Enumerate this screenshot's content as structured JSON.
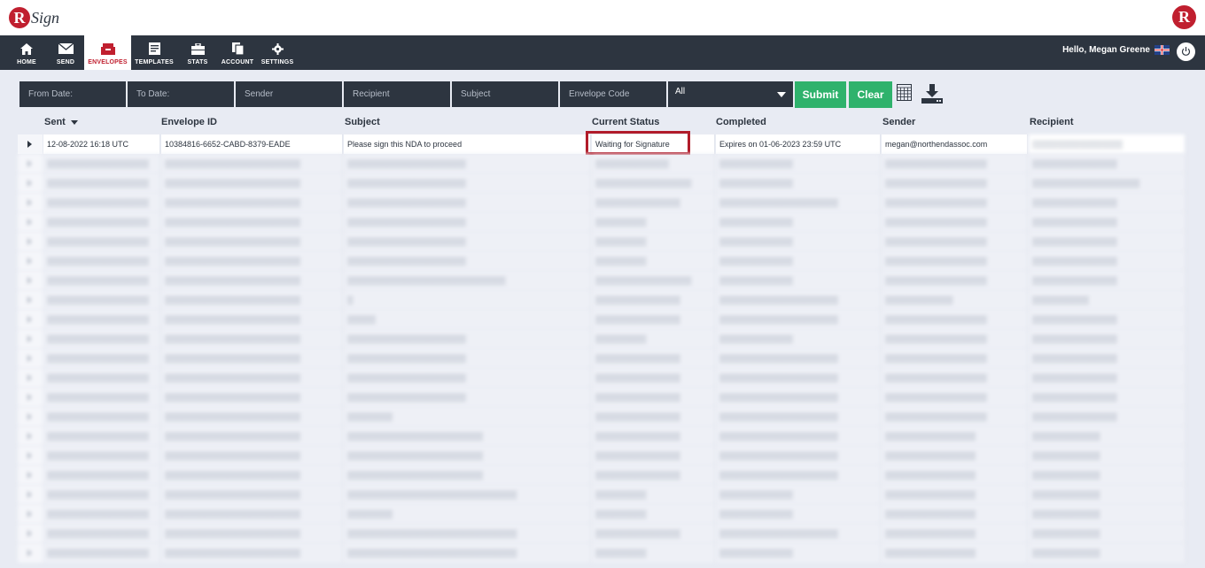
{
  "brand": {
    "logo_letter": "R",
    "logo_text": "Sign"
  },
  "nav": {
    "items": [
      {
        "label": "HOME",
        "icon": "home-icon"
      },
      {
        "label": "SEND",
        "icon": "envelope-icon"
      },
      {
        "label": "ENVELOPES",
        "icon": "inbox-icon"
      },
      {
        "label": "TEMPLATES",
        "icon": "template-icon"
      },
      {
        "label": "STATS",
        "icon": "briefcase-icon"
      },
      {
        "label": "ACCOUNT",
        "icon": "account-icon"
      },
      {
        "label": "SETTINGS",
        "icon": "gear-icon"
      }
    ],
    "active": "ENVELOPES"
  },
  "user": {
    "greeting": "Hello, Megan Greene"
  },
  "filters": {
    "from_date": "From Date:",
    "to_date": "To Date:",
    "sender": "Sender",
    "recipient": "Recipient",
    "subject": "Subject",
    "envelope_code": "Envelope Code",
    "status_select": "All",
    "submit": "Submit",
    "clear": "Clear"
  },
  "table": {
    "columns": [
      "Sent",
      "Envelope ID",
      "Subject",
      "Current Status",
      "Completed",
      "Sender",
      "Recipient"
    ],
    "first_row": {
      "sent": "12-08-2022 16:18 UTC",
      "envelope_id": "10384816-6652-CABD-8379-EADE",
      "subject": "Please sign this NDA to proceed",
      "status": "Waiting for Signature",
      "completed": "Expires on 01-06-2023 23:59 UTC",
      "sender": "megan@northendassoc.com",
      "recipient": "▒▒▒▒▒▒▒▒▒▒▒▒▒▒▒▒"
    },
    "blurred_rows": [
      [
        "▒▒▒▒▒▒▒▒▒▒▒▒▒▒▒▒▒▒",
        "▒▒▒▒▒▒▒▒▒▒▒▒▒▒▒▒▒▒▒▒▒▒▒▒",
        "▒▒▒▒▒▒▒▒▒▒▒▒▒▒▒▒▒▒▒▒▒",
        "▒▒▒▒▒▒▒▒▒▒▒▒▒",
        "▒▒▒▒▒▒▒▒▒▒▒▒▒",
        "▒▒▒▒▒▒▒▒▒▒▒▒▒▒▒▒▒▒",
        "▒▒▒▒▒▒▒▒▒▒▒▒▒▒▒"
      ],
      [
        "▒▒▒▒▒▒▒▒▒▒▒▒▒▒▒▒▒▒",
        "▒▒▒▒▒▒▒▒▒▒▒▒▒▒▒▒▒▒▒▒▒▒▒▒",
        "▒▒▒▒▒▒▒▒▒▒▒▒▒▒▒▒▒▒▒▒▒",
        "▒▒▒▒▒▒▒▒▒▒▒▒▒▒▒▒▒",
        "▒▒▒▒▒▒▒▒▒▒▒▒▒",
        "▒▒▒▒▒▒▒▒▒▒▒▒▒▒▒▒▒▒",
        "▒▒▒▒▒▒▒▒▒▒▒▒▒▒▒▒▒▒▒"
      ],
      [
        "▒▒▒▒▒▒▒▒▒▒▒▒▒▒▒▒▒▒",
        "▒▒▒▒▒▒▒▒▒▒▒▒▒▒▒▒▒▒▒▒▒▒▒▒",
        "▒▒▒▒▒▒▒▒▒▒▒▒▒▒▒▒▒▒▒▒▒",
        "▒▒▒▒▒▒▒▒▒▒▒▒▒▒▒",
        "▒▒▒▒▒▒▒▒▒▒▒▒▒▒▒▒▒▒▒▒▒",
        "▒▒▒▒▒▒▒▒▒▒▒▒▒▒▒▒▒▒",
        "▒▒▒▒▒▒▒▒▒▒▒▒▒▒▒"
      ],
      [
        "▒▒▒▒▒▒▒▒▒▒▒▒▒▒▒▒▒▒",
        "▒▒▒▒▒▒▒▒▒▒▒▒▒▒▒▒▒▒▒▒▒▒▒▒",
        "▒▒▒▒▒▒▒▒▒▒▒▒▒▒▒▒▒▒▒▒▒",
        "▒▒▒▒▒▒▒▒▒",
        "▒▒▒▒▒▒▒▒▒▒▒▒▒",
        "▒▒▒▒▒▒▒▒▒▒▒▒▒▒▒▒▒▒",
        "▒▒▒▒▒▒▒▒▒▒▒▒▒▒▒"
      ],
      [
        "▒▒▒▒▒▒▒▒▒▒▒▒▒▒▒▒▒▒",
        "▒▒▒▒▒▒▒▒▒▒▒▒▒▒▒▒▒▒▒▒▒▒▒▒",
        "▒▒▒▒▒▒▒▒▒▒▒▒▒▒▒▒▒▒▒▒▒",
        "▒▒▒▒▒▒▒▒▒",
        "▒▒▒▒▒▒▒▒▒▒▒▒▒",
        "▒▒▒▒▒▒▒▒▒▒▒▒▒▒▒▒▒▒",
        "▒▒▒▒▒▒▒▒▒▒▒▒▒▒▒"
      ],
      [
        "▒▒▒▒▒▒▒▒▒▒▒▒▒▒▒▒▒▒",
        "▒▒▒▒▒▒▒▒▒▒▒▒▒▒▒▒▒▒▒▒▒▒▒▒",
        "▒▒▒▒▒▒▒▒▒▒▒▒▒▒▒▒▒▒▒▒▒",
        "▒▒▒▒▒▒▒▒▒",
        "▒▒▒▒▒▒▒▒▒▒▒▒▒",
        "▒▒▒▒▒▒▒▒▒▒▒▒▒▒▒▒▒▒",
        "▒▒▒▒▒▒▒▒▒▒▒▒▒▒▒"
      ],
      [
        "▒▒▒▒▒▒▒▒▒▒▒▒▒▒▒▒▒▒",
        "▒▒▒▒▒▒▒▒▒▒▒▒▒▒▒▒▒▒▒▒▒▒▒▒",
        "▒▒▒▒▒▒▒▒▒▒▒▒▒▒▒▒▒▒▒▒▒▒▒▒▒▒▒▒",
        "▒▒▒▒▒▒▒▒▒▒▒▒▒▒▒▒▒",
        "▒▒▒▒▒▒▒▒▒▒▒▒▒",
        "▒▒▒▒▒▒▒▒▒▒▒▒▒▒▒▒▒▒",
        "▒▒▒▒▒▒▒▒▒▒▒▒▒▒▒"
      ],
      [
        "▒▒▒▒▒▒▒▒▒▒▒▒▒▒▒▒▒▒",
        "▒▒▒▒▒▒▒▒▒▒▒▒▒▒▒▒▒▒▒▒▒▒▒▒",
        "▒",
        "▒▒▒▒▒▒▒▒▒▒▒▒▒▒▒",
        "▒▒▒▒▒▒▒▒▒▒▒▒▒▒▒▒▒▒▒▒▒",
        "▒▒▒▒▒▒▒▒▒▒▒▒",
        "▒▒▒▒▒▒▒▒▒▒"
      ],
      [
        "▒▒▒▒▒▒▒▒▒▒▒▒▒▒▒▒▒▒",
        "▒▒▒▒▒▒▒▒▒▒▒▒▒▒▒▒▒▒▒▒▒▒▒▒",
        "▒▒▒▒▒",
        "▒▒▒▒▒▒▒▒▒▒▒▒▒▒▒",
        "▒▒▒▒▒▒▒▒▒▒▒▒▒▒▒▒▒▒▒▒▒",
        "▒▒▒▒▒▒▒▒▒▒▒▒▒▒▒▒▒▒",
        "▒▒▒▒▒▒▒▒▒▒▒▒▒▒▒"
      ],
      [
        "▒▒▒▒▒▒▒▒▒▒▒▒▒▒▒▒▒▒",
        "▒▒▒▒▒▒▒▒▒▒▒▒▒▒▒▒▒▒▒▒▒▒▒▒",
        "▒▒▒▒▒▒▒▒▒▒▒▒▒▒▒▒▒▒▒▒▒",
        "▒▒▒▒▒▒▒▒▒",
        "▒▒▒▒▒▒▒▒▒▒▒▒▒",
        "▒▒▒▒▒▒▒▒▒▒▒▒▒▒▒▒▒▒",
        "▒▒▒▒▒▒▒▒▒▒▒▒▒▒▒"
      ],
      [
        "▒▒▒▒▒▒▒▒▒▒▒▒▒▒▒▒▒▒",
        "▒▒▒▒▒▒▒▒▒▒▒▒▒▒▒▒▒▒▒▒▒▒▒▒",
        "▒▒▒▒▒▒▒▒▒▒▒▒▒▒▒▒▒▒▒▒▒",
        "▒▒▒▒▒▒▒▒▒▒▒▒▒▒▒",
        "▒▒▒▒▒▒▒▒▒▒▒▒▒▒▒▒▒▒▒▒▒",
        "▒▒▒▒▒▒▒▒▒▒▒▒▒▒▒▒▒▒",
        "▒▒▒▒▒▒▒▒▒▒▒▒▒▒▒"
      ],
      [
        "▒▒▒▒▒▒▒▒▒▒▒▒▒▒▒▒▒▒",
        "▒▒▒▒▒▒▒▒▒▒▒▒▒▒▒▒▒▒▒▒▒▒▒▒",
        "▒▒▒▒▒▒▒▒▒▒▒▒▒▒▒▒▒▒▒▒▒",
        "▒▒▒▒▒▒▒▒▒▒▒▒▒▒▒",
        "▒▒▒▒▒▒▒▒▒▒▒▒▒▒▒▒▒▒▒▒▒",
        "▒▒▒▒▒▒▒▒▒▒▒▒▒▒▒▒▒▒",
        "▒▒▒▒▒▒▒▒▒▒▒▒▒▒▒"
      ],
      [
        "▒▒▒▒▒▒▒▒▒▒▒▒▒▒▒▒▒▒",
        "▒▒▒▒▒▒▒▒▒▒▒▒▒▒▒▒▒▒▒▒▒▒▒▒",
        "▒▒▒▒▒▒▒▒▒▒▒▒▒▒▒▒▒▒▒▒▒",
        "▒▒▒▒▒▒▒▒▒▒▒▒▒▒▒",
        "▒▒▒▒▒▒▒▒▒▒▒▒▒▒▒▒▒▒▒▒▒",
        "▒▒▒▒▒▒▒▒▒▒▒▒▒▒▒▒▒▒",
        "▒▒▒▒▒▒▒▒▒▒▒▒▒▒▒"
      ],
      [
        "▒▒▒▒▒▒▒▒▒▒▒▒▒▒▒▒▒▒",
        "▒▒▒▒▒▒▒▒▒▒▒▒▒▒▒▒▒▒▒▒▒▒▒▒",
        "▒▒▒▒▒▒▒▒",
        "▒▒▒▒▒▒▒▒▒▒▒▒▒▒▒",
        "▒▒▒▒▒▒▒▒▒▒▒▒▒▒▒▒▒▒▒▒▒",
        "▒▒▒▒▒▒▒▒▒▒▒▒▒▒▒▒▒▒",
        "▒▒▒▒▒▒▒▒▒▒▒▒▒▒▒"
      ],
      [
        "▒▒▒▒▒▒▒▒▒▒▒▒▒▒▒▒▒▒",
        "▒▒▒▒▒▒▒▒▒▒▒▒▒▒▒▒▒▒▒▒▒▒▒▒",
        "▒▒▒▒▒▒▒▒▒▒▒▒▒▒▒▒▒▒▒▒▒▒▒▒",
        "▒▒▒▒▒▒▒▒▒▒▒▒▒▒▒",
        "▒▒▒▒▒▒▒▒▒▒▒▒▒▒▒▒▒▒▒▒▒",
        "▒▒▒▒▒▒▒▒▒▒▒▒▒▒▒▒",
        "▒▒▒▒▒▒▒▒▒▒▒▒"
      ],
      [
        "▒▒▒▒▒▒▒▒▒▒▒▒▒▒▒▒▒▒",
        "▒▒▒▒▒▒▒▒▒▒▒▒▒▒▒▒▒▒▒▒▒▒▒▒",
        "▒▒▒▒▒▒▒▒▒▒▒▒▒▒▒▒▒▒▒▒▒▒▒▒",
        "▒▒▒▒▒▒▒▒▒▒▒▒▒▒▒",
        "▒▒▒▒▒▒▒▒▒▒▒▒▒▒▒▒▒▒▒▒▒",
        "▒▒▒▒▒▒▒▒▒▒▒▒▒▒▒▒",
        "▒▒▒▒▒▒▒▒▒▒▒▒"
      ],
      [
        "▒▒▒▒▒▒▒▒▒▒▒▒▒▒▒▒▒▒",
        "▒▒▒▒▒▒▒▒▒▒▒▒▒▒▒▒▒▒▒▒▒▒▒▒",
        "▒▒▒▒▒▒▒▒▒▒▒▒▒▒▒▒▒▒▒▒▒▒▒▒",
        "▒▒▒▒▒▒▒▒▒▒▒▒▒▒▒",
        "▒▒▒▒▒▒▒▒▒▒▒▒▒▒▒▒▒▒▒▒▒",
        "▒▒▒▒▒▒▒▒▒▒▒▒▒▒▒▒",
        "▒▒▒▒▒▒▒▒▒▒▒▒"
      ],
      [
        "▒▒▒▒▒▒▒▒▒▒▒▒▒▒▒▒▒▒",
        "▒▒▒▒▒▒▒▒▒▒▒▒▒▒▒▒▒▒▒▒▒▒▒▒",
        "▒▒▒▒▒▒▒▒▒▒▒▒▒▒▒▒▒▒▒▒▒▒▒▒▒▒▒▒▒▒",
        "▒▒▒▒▒▒▒▒▒",
        "▒▒▒▒▒▒▒▒▒▒▒▒▒",
        "▒▒▒▒▒▒▒▒▒▒▒▒▒▒▒▒",
        "▒▒▒▒▒▒▒▒▒▒▒▒"
      ],
      [
        "▒▒▒▒▒▒▒▒▒▒▒▒▒▒▒▒▒▒",
        "▒▒▒▒▒▒▒▒▒▒▒▒▒▒▒▒▒▒▒▒▒▒▒▒",
        "▒▒▒▒▒▒▒▒",
        "▒▒▒▒▒▒▒▒▒",
        "▒▒▒▒▒▒▒▒▒▒▒▒▒",
        "▒▒▒▒▒▒▒▒▒▒▒▒▒▒▒▒",
        "▒▒▒▒▒▒▒▒▒▒▒▒"
      ],
      [
        "▒▒▒▒▒▒▒▒▒▒▒▒▒▒▒▒▒▒",
        "▒▒▒▒▒▒▒▒▒▒▒▒▒▒▒▒▒▒▒▒▒▒▒▒",
        "▒▒▒▒▒▒▒▒▒▒▒▒▒▒▒▒▒▒▒▒▒▒▒▒▒▒▒▒▒▒",
        "▒▒▒▒▒▒▒▒▒▒▒▒▒▒▒",
        "▒▒▒▒▒▒▒▒▒▒▒▒▒▒▒▒▒▒▒▒▒",
        "▒▒▒▒▒▒▒▒▒▒▒▒▒▒▒▒",
        "▒▒▒▒▒▒▒▒▒▒▒▒"
      ],
      [
        "▒▒▒▒▒▒▒▒▒▒▒▒▒▒▒▒▒▒",
        "▒▒▒▒▒▒▒▒▒▒▒▒▒▒▒▒▒▒▒▒▒▒▒▒",
        "▒▒▒▒▒▒▒▒▒▒▒▒▒▒▒▒▒▒▒▒▒▒▒▒▒▒▒▒▒▒",
        "▒▒▒▒▒▒▒▒▒",
        "▒▒▒▒▒▒▒▒▒▒▒▒▒",
        "▒▒▒▒▒▒▒▒▒▒▒▒▒▒▒▒",
        "▒▒▒▒▒▒▒▒▒▒▒▒"
      ]
    ]
  },
  "colors": {
    "nav_bg": "#2d3540",
    "accent_red": "#c01f2f",
    "button_green": "#2fb26c",
    "highlight_border": "#b11c2a"
  }
}
